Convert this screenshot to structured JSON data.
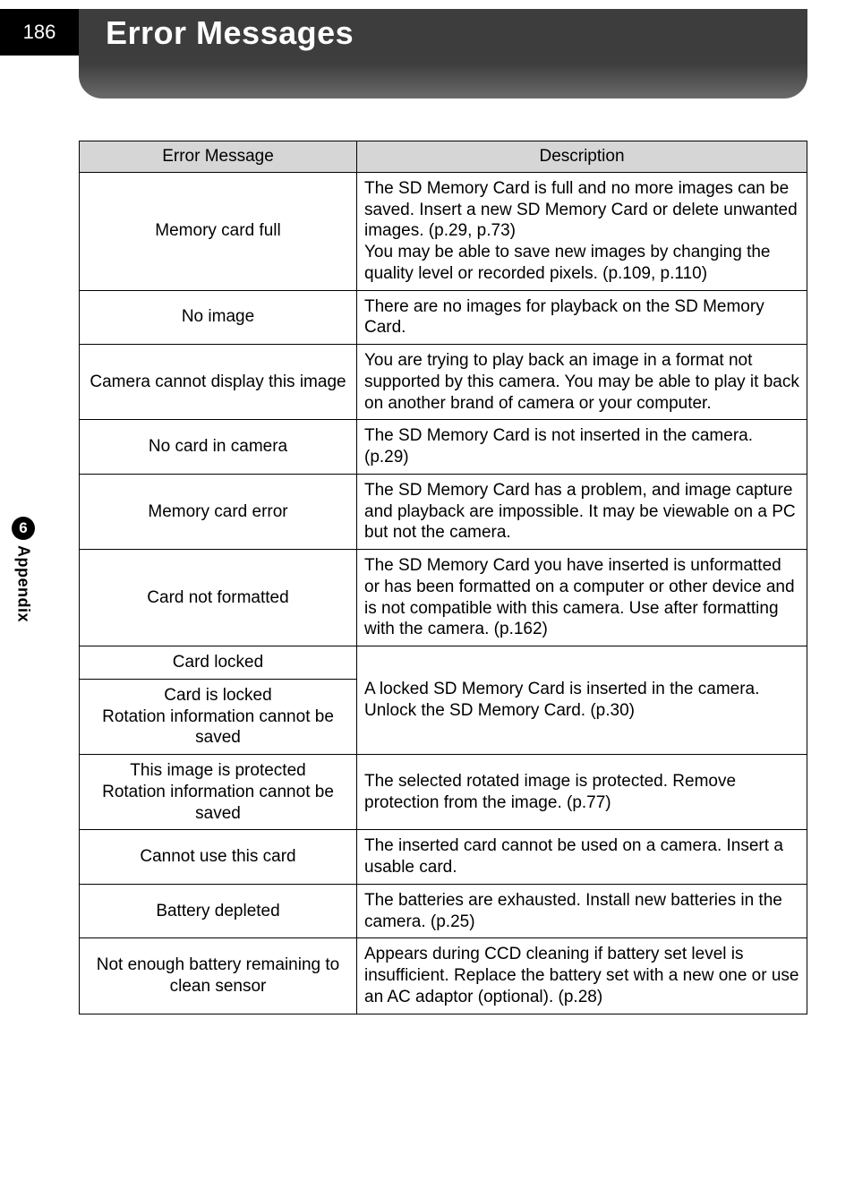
{
  "page_number": "186",
  "title": "Error Messages",
  "side_tab": {
    "number": "6",
    "label": "Appendix"
  },
  "table": {
    "headers": [
      "Error Message",
      "Description"
    ],
    "rows": [
      {
        "msg": "Memory card full",
        "desc": "The SD Memory Card is full and no more images can be saved. Insert a new SD Memory Card or delete unwanted images. (p.29, p.73)\nYou may be able to save new images by changing the quality level or recorded pixels. (p.109, p.110)"
      },
      {
        "msg": "No image",
        "desc": "There are no images for playback on the SD Memory Card."
      },
      {
        "msg": "Camera cannot display this image",
        "desc": "You are trying to play back an image in a format not supported by this camera. You may be able to play it back on another brand of camera or your computer."
      },
      {
        "msg": "No card in camera",
        "desc": "The SD Memory Card is not inserted in the camera. (p.29)"
      },
      {
        "msg": "Memory card error",
        "desc": "The SD Memory Card has a problem, and image capture and playback are impossible. It may be viewable on a PC but not the camera."
      },
      {
        "msg": "Card not formatted",
        "desc": "The SD Memory Card you have inserted is unformatted or has been formatted on a computer or other device and is not compatible with this camera. Use after formatting with the camera. (p.162)"
      },
      {
        "msg": "Card locked",
        "desc_span": true
      },
      {
        "msg": "Card is locked\nRotation information cannot be saved",
        "desc": "A locked SD Memory Card is inserted in the camera. Unlock the SD Memory Card. (p.30)"
      },
      {
        "msg": "This image is protected\nRotation information cannot be saved",
        "desc": "The selected rotated image is protected. Remove protection from the image. (p.77)"
      },
      {
        "msg": "Cannot use this card",
        "desc": "The inserted card cannot be used on a camera. Insert a usable card."
      },
      {
        "msg": "Battery depleted",
        "desc": "The batteries are exhausted. Install new batteries in the camera. (p.25)"
      },
      {
        "msg": "Not enough battery remaining to clean sensor",
        "desc": "Appears during CCD cleaning if battery set level is insufficient. Replace the battery set with a new one or use an AC adaptor (optional). (p.28)"
      }
    ]
  }
}
